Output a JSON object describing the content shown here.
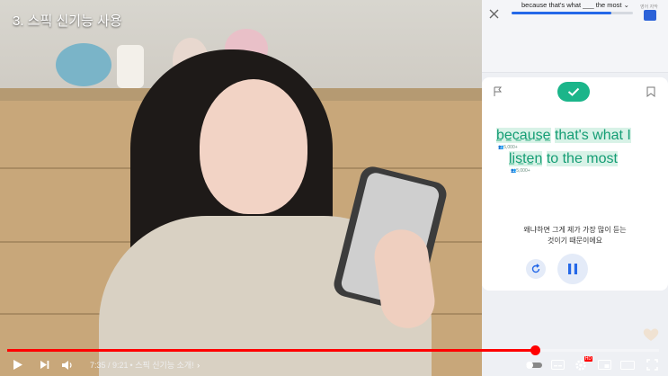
{
  "video": {
    "overlay_title": "3. 스픽 신기능 사용",
    "time": "7:35 / 9:21",
    "chapter": "• 스픽 신기능 소개!",
    "progress_fraction": 0.81,
    "icons": [
      "play-icon",
      "next-icon",
      "volume-icon",
      "chevron-right-icon",
      "autoplay-toggle-icon",
      "subtitles-icon",
      "settings-icon",
      "miniplayer-icon",
      "theater-icon",
      "fullscreen-icon"
    ],
    "settings_badge": "HD"
  },
  "app": {
    "sentence_select": "because that's what ___ the most",
    "mini_label": "영어 자막",
    "lesson_progress_fraction": 0.82,
    "sentence_parts": [
      "because",
      "that's what I",
      "listen",
      "to the most"
    ],
    "freq_1": "5,000+",
    "freq_2": "5,000+",
    "translation_line1": "왜냐하면 그게 제가 가장 많이 듣는",
    "translation_line2": "것이기 때문이에요",
    "accent_color": "#1bb58a",
    "brand_color": "#2468e8"
  }
}
